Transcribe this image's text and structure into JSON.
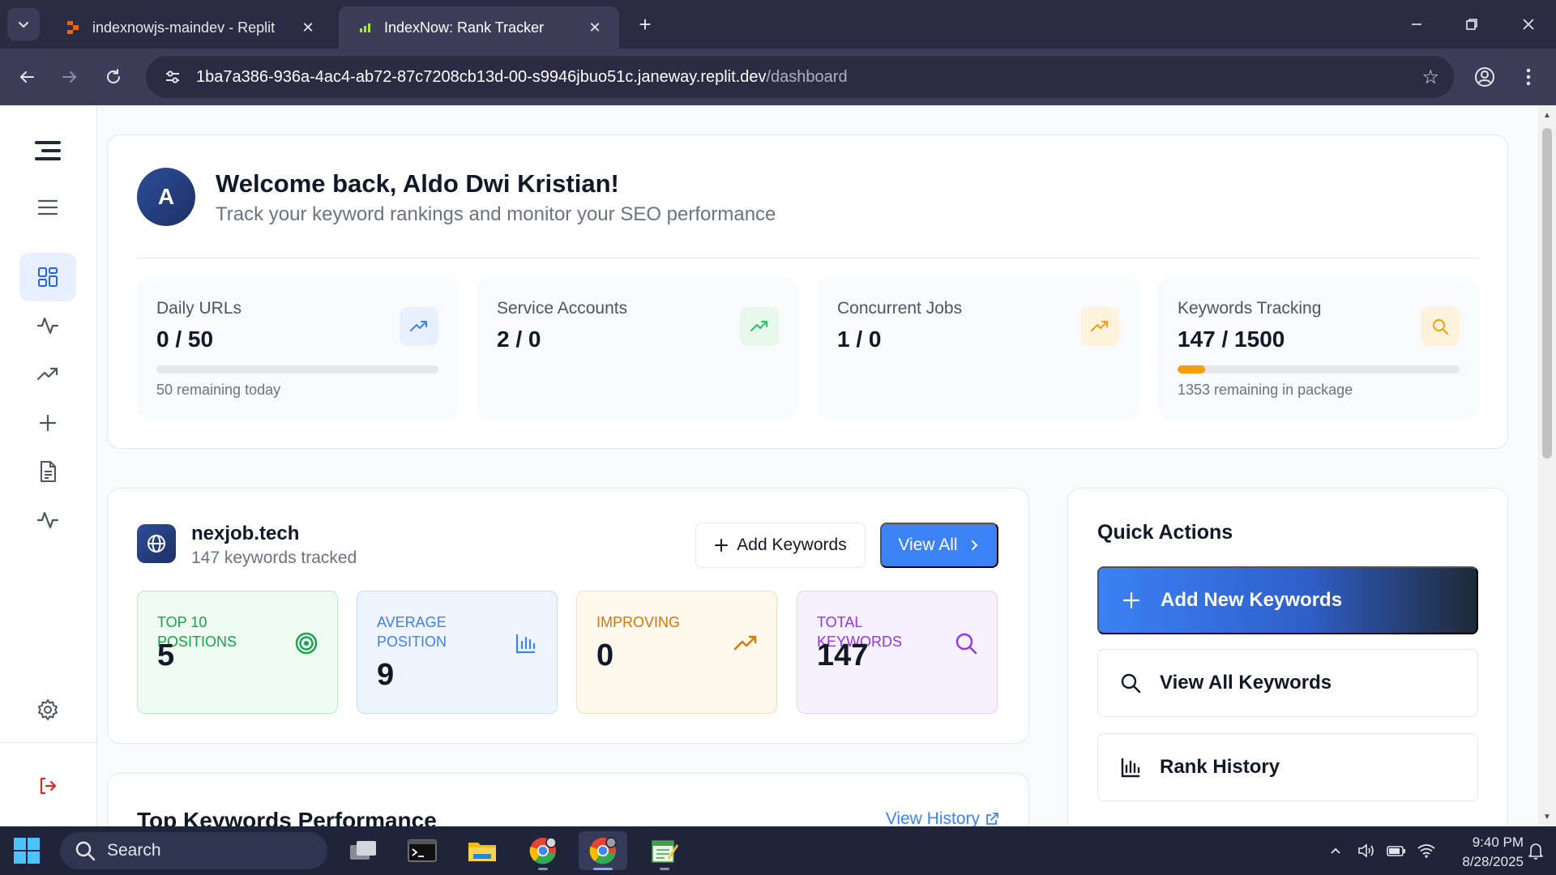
{
  "browser": {
    "tabs": [
      {
        "title": "indexnowjs-maindev - Replit",
        "active": false
      },
      {
        "title": "IndexNow: Rank Tracker",
        "active": true
      }
    ],
    "url_host": "1ba7a386-936a-4ac4-ab72-87c7208cb13d-00-s9946jbuo51c.janeway.replit.dev",
    "url_path": "/dashboard"
  },
  "sidebar": {
    "items": [
      "logo",
      "menu",
      "dashboard",
      "activity",
      "rank-trends",
      "add",
      "documents",
      "analytics"
    ],
    "active": "dashboard",
    "bottom": [
      "settings",
      "logout"
    ]
  },
  "welcome": {
    "avatar_initial": "A",
    "title": "Welcome back, Aldo Dwi Kristian!",
    "subtitle": "Track your keyword rankings and monitor your SEO performance"
  },
  "stats": [
    {
      "label": "Daily URLs",
      "value": "0 / 50",
      "note": "50 remaining today",
      "progress": 0.0,
      "icon": "trending-up-icon",
      "color": "#3b82f6",
      "bg": "#e8efff"
    },
    {
      "label": "Service Accounts",
      "value": "2 / 0",
      "note": "",
      "icon": "trending-up-icon",
      "color": "#22c55e",
      "bg": "#e7f7ec"
    },
    {
      "label": "Concurrent Jobs",
      "value": "1 / 0",
      "note": "",
      "icon": "trending-up-icon",
      "color": "#f59e0b",
      "bg": "#fdf3dd"
    },
    {
      "label": "Keywords Tracking",
      "value": "147 / 1500",
      "note": "1353 remaining in package",
      "progress": 0.098,
      "icon": "search-icon",
      "color": "#f59e0b",
      "bg": "#fdf3dd"
    }
  ],
  "domain": {
    "name": "nexjob.tech",
    "subtitle": "147 keywords tracked",
    "add_keywords_label": "Add Keywords",
    "view_all_label": "View All",
    "metrics": [
      {
        "label": "Top 10 Positions",
        "value": "5",
        "color": "#16a34a",
        "bg": "#effbf2",
        "border": "#bbe8c8",
        "icon": "target-icon"
      },
      {
        "label": "Average Position",
        "value": "9",
        "color": "#3b82f6",
        "bg": "#eff5ff",
        "border": "#c7dbfb",
        "icon": "bar-chart-icon"
      },
      {
        "label": "Improving",
        "value": "0",
        "color": "#d97706",
        "bg": "#fff8ec",
        "border": "#f6dfb3",
        "icon": "trending-up-icon"
      },
      {
        "label": "Total Keywords",
        "value": "147",
        "color": "#9333ea",
        "bg": "#f7f1ff",
        "border": "#e2cffb",
        "icon": "search-icon"
      }
    ]
  },
  "top_keywords": {
    "title": "Top Keywords Performance",
    "view_history_label": "View History"
  },
  "quick_actions": {
    "title": "Quick Actions",
    "items": [
      {
        "label": "Add New Keywords",
        "icon": "plus-icon",
        "primary": true
      },
      {
        "label": "View All Keywords",
        "icon": "search-icon",
        "primary": false
      },
      {
        "label": "Rank History",
        "icon": "bar-chart-icon",
        "primary": false
      }
    ]
  },
  "taskbar": {
    "search_placeholder": "Search",
    "time": "9:40 PM",
    "date": "8/28/2025"
  },
  "colors": {
    "accent": "#3b82f6",
    "chrome_dark": "#2b2b44",
    "chrome_mid": "#3d3d5a",
    "taskbar": "#20243a"
  }
}
